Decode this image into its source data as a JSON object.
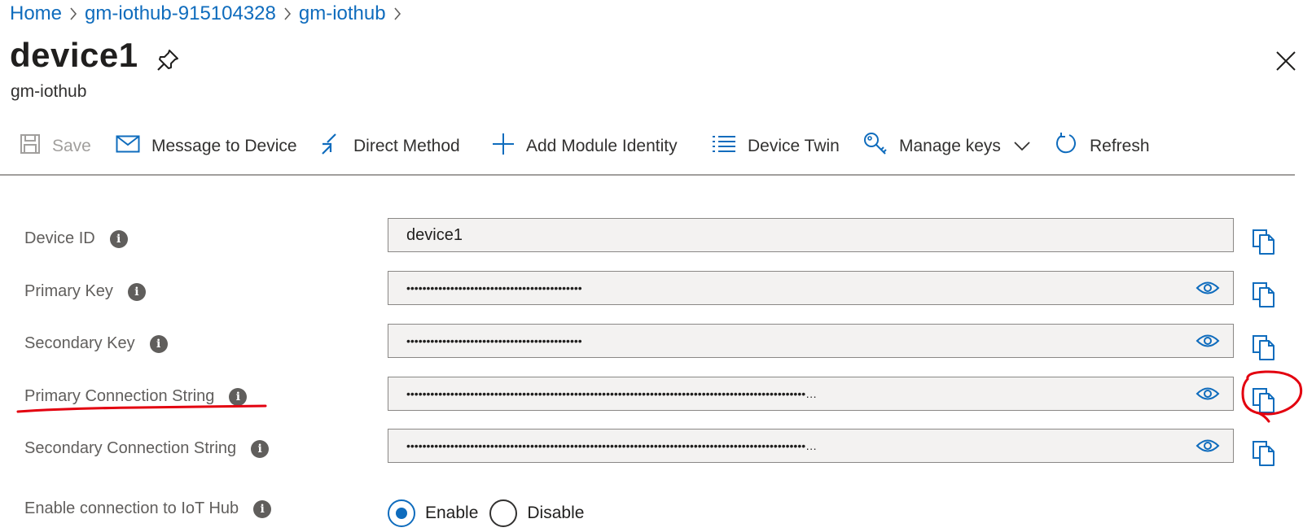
{
  "breadcrumb": {
    "items": [
      "Home",
      "gm-iothub-915104328",
      "gm-iothub"
    ]
  },
  "header": {
    "title": "device1",
    "subtitle": "gm-iothub"
  },
  "toolbar": {
    "save": "Save",
    "message_to_device": "Message to Device",
    "direct_method": "Direct Method",
    "add_module_identity": "Add Module Identity",
    "device_twin": "Device Twin",
    "manage_keys": "Manage keys",
    "refresh": "Refresh"
  },
  "form": {
    "device_id": {
      "label": "Device ID",
      "value": "device1"
    },
    "primary_key": {
      "label": "Primary Key",
      "value": "••••••••••••••••••••••••••••••••••••••••••••"
    },
    "secondary_key": {
      "label": "Secondary Key",
      "value": "••••••••••••••••••••••••••••••••••••••••••••"
    },
    "primary_connection_string": {
      "label": "Primary Connection String",
      "value": "••••••••••••••••••••••••••••••••••••••••••••••••••••••••••••••••••••••••••••••••••••••••••••••••••••…"
    },
    "secondary_connection_string": {
      "label": "Secondary Connection String",
      "value": "••••••••••••••••••••••••••••••••••••••••••••••••••••••••••••••••••••••••••••••••••••••••••••••••••••…"
    },
    "enable_connection": {
      "label": "Enable connection to IoT Hub",
      "options": [
        "Enable",
        "Disable"
      ],
      "selected": "Enable"
    },
    "info_glyph": "i"
  },
  "colors": {
    "accent": "#0f6cbd",
    "annotation": "#e3000f"
  }
}
